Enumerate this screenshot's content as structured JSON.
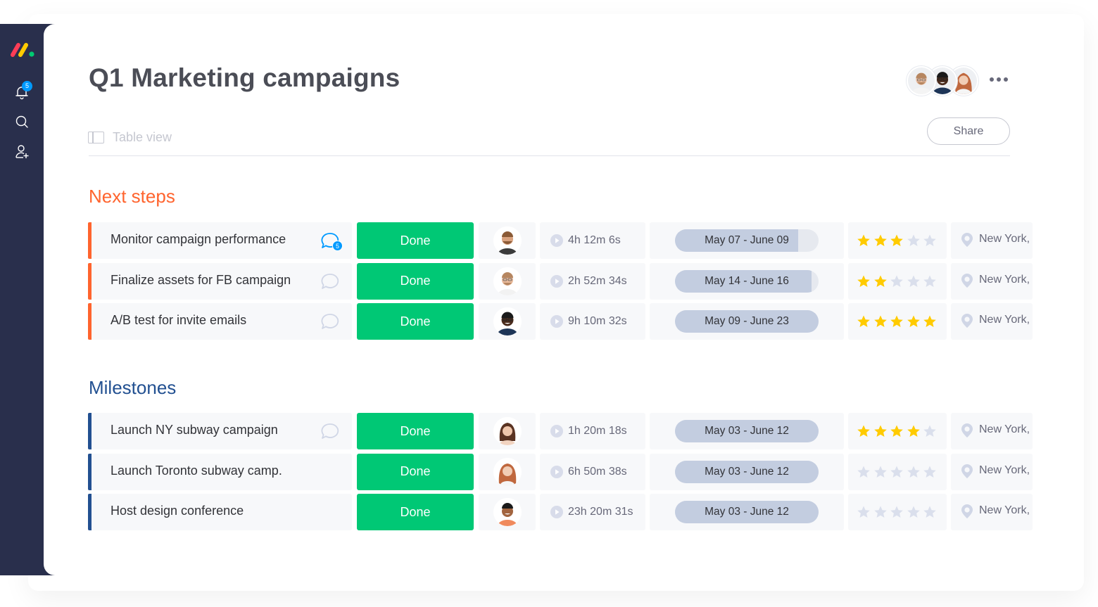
{
  "app": {
    "notifications_count": "5",
    "sidebar_icons": [
      "monday-logo",
      "bell-icon",
      "search-icon",
      "invite-user-icon"
    ]
  },
  "board": {
    "title": "Q1 Marketing campaigns",
    "view_label": "Table view",
    "share_label": "Share",
    "member_avatars": [
      "man-glasses-beard",
      "man-dark-glasses",
      "woman-red-hair"
    ]
  },
  "colors": {
    "next_steps": "#ff642e",
    "milestones": "#225091",
    "done": "#00c875",
    "star_on": "#ffcb00",
    "star_off": "#dadfec",
    "timeline": "#c3cde0",
    "notification": "#009aff"
  },
  "groups": [
    {
      "title": "Next steps",
      "color": "#ff642e",
      "rows": [
        {
          "name": "Monitor campaign performance",
          "comments": "5",
          "has_chat_icon": true,
          "status": "Done",
          "person": "man-beard",
          "time": "4h 12m 6s",
          "timeline": "May 07 - June 09",
          "timeline_progress": 0.86,
          "rating": 3,
          "location": "New York,"
        },
        {
          "name": "Finalize assets for FB campaign",
          "comments": "",
          "has_chat_icon": true,
          "status": "Done",
          "person": "man-glasses-beard",
          "time": "2h 52m 34s",
          "timeline": "May 14 - June 16",
          "timeline_progress": 0.95,
          "rating": 2,
          "location": "New York,"
        },
        {
          "name": "A/B test for invite emails",
          "comments": "",
          "has_chat_icon": true,
          "status": "Done",
          "person": "man-dark-glasses",
          "time": "9h 10m 32s",
          "timeline": "May 09 - June 23",
          "timeline_progress": 1.0,
          "rating": 5,
          "location": "New York,"
        }
      ]
    },
    {
      "title": "Milestones",
      "color": "#225091",
      "rows": [
        {
          "name": "Launch NY subway campaign",
          "comments": "",
          "has_chat_icon": true,
          "status": "Done",
          "person": "woman-brown-hair",
          "time": "1h 20m 18s",
          "timeline": "May 03 - June 12",
          "timeline_progress": 1.0,
          "rating": 4,
          "location": "New York,"
        },
        {
          "name": "Launch Toronto subway camp.",
          "comments": "",
          "has_chat_icon": false,
          "status": "Done",
          "person": "woman-red-hair",
          "time": "6h 50m 38s",
          "timeline": "May 03 - June 12",
          "timeline_progress": 1.0,
          "rating": 0,
          "location": "New York,"
        },
        {
          "name": "Host design conference",
          "comments": "",
          "has_chat_icon": false,
          "status": "Done",
          "person": "man-smiling",
          "time": "23h 20m 31s",
          "timeline": "May 03 - June 12",
          "timeline_progress": 1.0,
          "rating": 0,
          "location": "New York,"
        }
      ]
    }
  ]
}
